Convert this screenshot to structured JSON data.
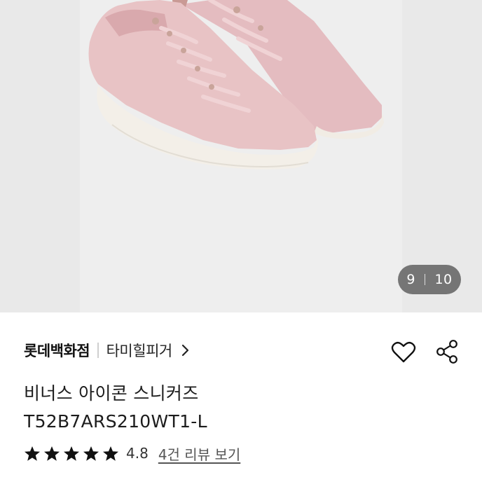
{
  "gallery": {
    "current_page": "9",
    "total_pages": "10",
    "image_subject": "pink sneakers product photo"
  },
  "product": {
    "store_name": "롯데백화점",
    "brand_name": "타미힐피거",
    "title_line1": "비너스 아이콘 스니커즈",
    "title_line2": "T52B7ARS210WT1-L"
  },
  "rating": {
    "stars": 5,
    "score": "4.8",
    "reviews_link": "4건 리뷰 보기"
  },
  "icons": {
    "like": "heart-outline-icon",
    "share": "share-icon",
    "brand_chevron": "chevron-right-icon",
    "star": "star-filled-icon"
  },
  "colors": {
    "shoe": "#e7c2c4",
    "sole": "#f3efe8",
    "star": "#111111"
  }
}
